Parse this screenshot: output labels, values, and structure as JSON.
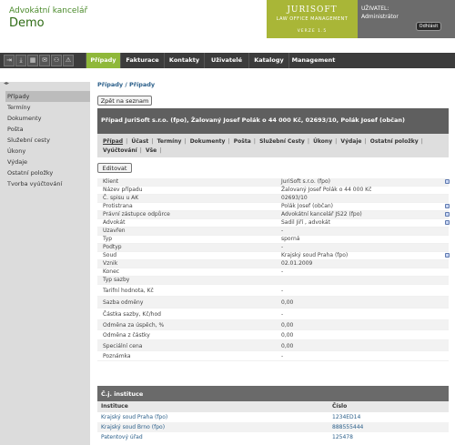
{
  "header": {
    "firm_sub": "Advokátní kancelář",
    "firm_name": "Demo",
    "logo_title": "JURISOFT",
    "logo_sub": "LAW OFFICE MANAGEMENT",
    "logo_version": "VERZE 1.5",
    "user_label": "UŽIVATEL:",
    "user_value": "Administrátor",
    "logout": "Odhlásit"
  },
  "toolbar_icons": [
    "logout-arrow-icon",
    "download-icon",
    "calendar-icon",
    "mail-icon",
    "users-icon",
    "warning-icon"
  ],
  "menu": {
    "tabs": [
      "Případy",
      "Fakturace",
      "Kontakty",
      "Uživatelé",
      "Katalogy",
      "Management"
    ],
    "active": "Případy"
  },
  "sidebar": {
    "toggle": "◂▸",
    "items": [
      "Případy",
      "Termíny",
      "Dokumenty",
      "Pošta",
      "Služební cesty",
      "Úkony",
      "Výdaje",
      "Ostatní položky",
      "Tvorba vyúčtování"
    ]
  },
  "main": {
    "breadcrumb": "Případy / Případy",
    "back_button": "Zpět na seznam",
    "case_title": "Případ JuriSoft s.r.o. (fpo), Žalovaný Josef Polák o 44 000 Kč, 02693/10, Polák Josef (občan)",
    "case_tabs_row1": [
      "Případ",
      "Účast",
      "Termíny",
      "Dokumenty",
      "Pošta",
      "Služební Cesty",
      "Úkony",
      "Výdaje",
      "Ostatní položky"
    ],
    "case_tabs_row2": [
      "Vyúčtování",
      "Vše"
    ],
    "edit_button": "Editovat"
  },
  "fields": [
    {
      "label": "Klient",
      "value": "JuriSoft s.r.o. (fpo)",
      "icon": true
    },
    {
      "label": "Název případu",
      "value": "Žalovaný Josef Polák o 44 000 Kč",
      "icon": false
    },
    {
      "label": "Č. spisu u AK",
      "value": "02693/10",
      "icon": false
    },
    {
      "label": "Protistrana",
      "value": "Polák Josef (občan)",
      "icon": true
    },
    {
      "label": "Právní zástupce odpůrce",
      "value": "Advokátní kancelář JS22 (fpo)",
      "icon": true
    },
    {
      "label": "Advokát",
      "value": "Sadil Jiří , advokát",
      "icon": true
    },
    {
      "label": "Uzavřen",
      "value": "-",
      "icon": false
    },
    {
      "label": "Typ",
      "value": "sporná",
      "icon": false
    },
    {
      "label": "Podtyp",
      "value": "-",
      "icon": false
    },
    {
      "label": "Soud",
      "value": "Krajský soud Praha (fpo)",
      "icon": true
    },
    {
      "label": "Vznik",
      "value": "02.01.2009",
      "icon": false
    },
    {
      "label": "Konec",
      "value": "-",
      "icon": false
    },
    {
      "label": "Typ sazby",
      "value": "",
      "icon": false
    },
    {
      "label": "Tarifní hodnota, Kč",
      "value": "-",
      "icon": false
    },
    {
      "label": "Sazba odměny",
      "value": "0,00",
      "icon": false
    },
    {
      "label": "Částka sazby, Kč/hod",
      "value": "-",
      "icon": false
    },
    {
      "label": "Odměna za úspěch, %",
      "value": "0,00",
      "icon": false
    },
    {
      "label": "Odměna z částky",
      "value": "0,00",
      "icon": false
    },
    {
      "label": "Speciální cena",
      "value": "0,00",
      "icon": false
    },
    {
      "label": "Poznámka",
      "value": "-",
      "icon": false
    }
  ],
  "institutions": {
    "title": "Č.j. instituce",
    "col_institution": "Instituce",
    "col_number": "Číslo",
    "rows": [
      {
        "name": "Krajský soud Praha (fpo)",
        "number": "1234ED14"
      },
      {
        "name": "Krajský soud Brno (fpo)",
        "number": "888555444"
      },
      {
        "name": "Patentový úřad",
        "number": "125478"
      }
    ]
  }
}
